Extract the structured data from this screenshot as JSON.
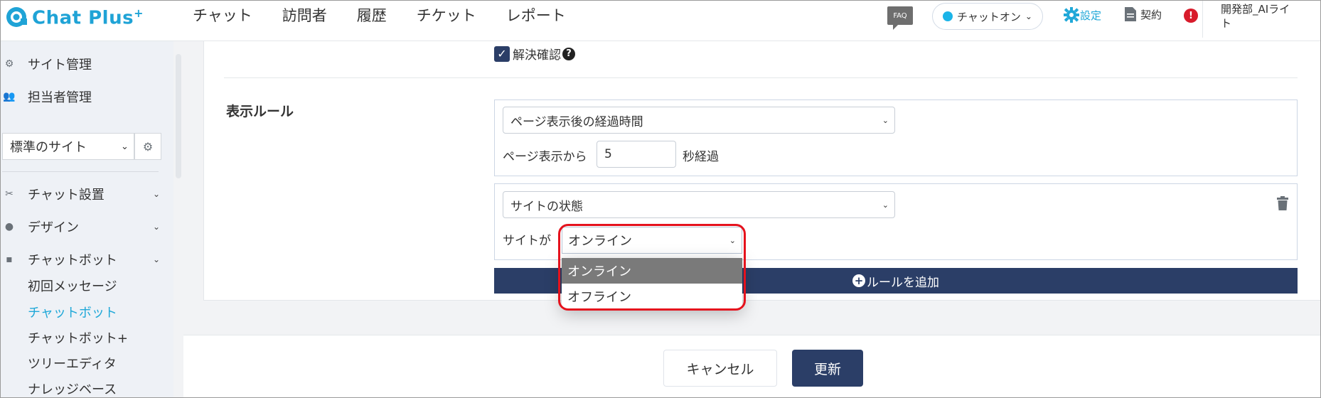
{
  "app": {
    "logo_text": "Chat Plus",
    "logo_sup": "+"
  },
  "nav": [
    "チャット",
    "訪問者",
    "履歴",
    "チケット",
    "レポート"
  ],
  "header": {
    "faq": "FAQ",
    "status": "チャットオン",
    "settings": "設定",
    "contract": "契約",
    "alert": "!",
    "user_line1": "開発部_AIライ",
    "user_line2": "ト"
  },
  "sidebar": {
    "site_management": "サイト管理",
    "staff_management": "担当者管理",
    "site_select": "標準のサイト",
    "chat_setup": "チャット設置",
    "design": "デザイン",
    "chatbot": "チャットボット",
    "sub_items": [
      "初回メッセージ",
      "チャットボット",
      "チャットボット+",
      "ツリーエディタ",
      "ナレッジベース"
    ],
    "active_sub_index": 1
  },
  "form": {
    "resolve_label": "解決確認",
    "resolve_checked": true,
    "display_rules_title": "表示ルール",
    "rule1": {
      "condition": "ページ表示後の経過時間",
      "prefix": "ページ表示から",
      "value": "5",
      "suffix": "秒経過"
    },
    "rule2": {
      "condition": "サイトの状態",
      "prefix": "サイトが",
      "value": "オンライン"
    },
    "add_rule": "ルールを追加"
  },
  "dropdown": {
    "options": [
      "オンライン",
      "オフライン"
    ],
    "selected_index": 0,
    "highlight_color": "#e5121d"
  },
  "buttons": {
    "cancel": "キャンセル",
    "update": "更新"
  },
  "colors": {
    "accent": "#20a8d8",
    "primary": "#2b3e67"
  }
}
